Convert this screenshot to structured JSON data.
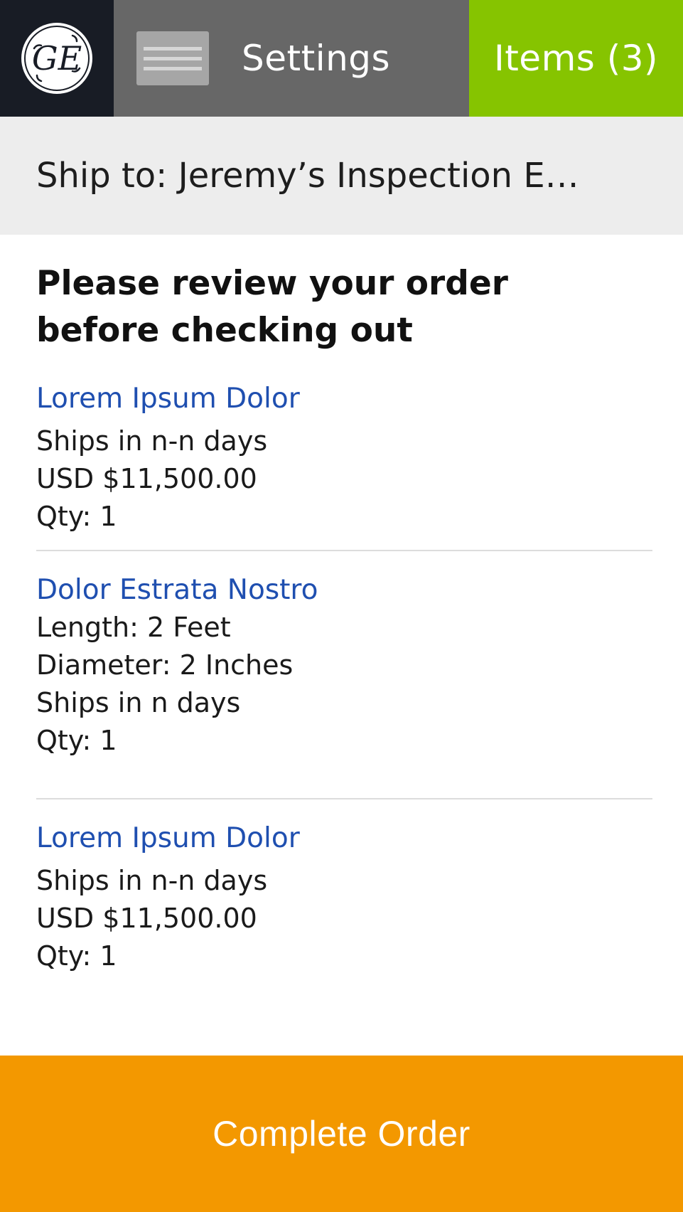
{
  "header": {
    "logo_icon": "ge-monogram-logo-icon",
    "menu_icon": "hamburger-menu-icon",
    "settings_label": "Settings",
    "items_label": "Items (3)"
  },
  "ship_to": {
    "text": "Ship to: Jeremy’s Inspection E…"
  },
  "review": {
    "heading": "Please review your order before checking out"
  },
  "order_items": [
    {
      "title": "Lorem Ipsum Dolor",
      "lines": [
        "Ships in n-n days",
        "USD $11,500.00",
        "Qty: 1"
      ]
    },
    {
      "title": "Dolor Estrata Nostro",
      "lines": [
        "Length: 2 Feet",
        "Diameter: 2 Inches",
        "Ships in n days",
        "Qty: 1"
      ]
    },
    {
      "title": "Lorem Ipsum Dolor",
      "lines": [
        "Ships in n-n days",
        "USD $11,500.00",
        "Qty: 1"
      ]
    }
  ],
  "footer": {
    "complete_label": "Complete Order"
  },
  "colors": {
    "logo_bg": "#181c25",
    "settings_bg": "#676767",
    "items_bg": "#86c400",
    "shipbar_bg": "#ededed",
    "link_blue": "#1f4fb0",
    "complete_bg": "#f39800"
  }
}
